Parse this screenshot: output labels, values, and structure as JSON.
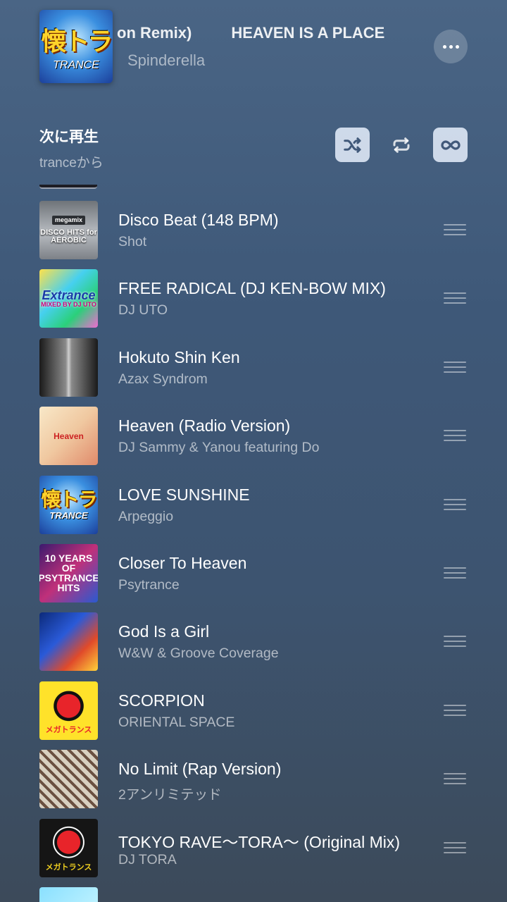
{
  "now_playing": {
    "title_visible": "on Remix)",
    "title_next": "HEAVEN IS A PLACE",
    "artist": "Spinderella",
    "artwork": {
      "text_big": "懐トラ",
      "text_small": "TRANCE"
    }
  },
  "queue": {
    "heading": "次に再生",
    "source": "tranceから",
    "controls": {
      "shuffle": "shuffle-icon",
      "repeat": "repeat-icon",
      "autoplay": "infinity-icon"
    }
  },
  "tracks": [
    {
      "title": "Disco Beat (148 BPM)",
      "artist": "Shot",
      "art_tag": "megamix",
      "art_text": "DISCO HITS for AEROBIC"
    },
    {
      "title": "FREE RADICAL (DJ KEN-BOW MIX)",
      "artist": "DJ UTO",
      "art_tag": "",
      "art_text": "Extrance",
      "art_sub": "MIXED BY DJ UTO"
    },
    {
      "title": "Hokuto Shin Ken",
      "artist": "Azax Syndrom",
      "art_text": ""
    },
    {
      "title": "Heaven (Radio Version)",
      "artist": "DJ Sammy & Yanou featuring Do",
      "art_text": "Heaven"
    },
    {
      "title": "LOVE SUNSHINE",
      "artist": "Arpeggio",
      "art_big": "懐トラ",
      "art_small": "TRANCE"
    },
    {
      "title": "Closer To Heaven",
      "artist": "Psytrance",
      "art_text": "10 YEARS OF PSYTRANCE HITS"
    },
    {
      "title": "God Is a Girl",
      "artist": "W&W & Groove Coverage",
      "art_text": ""
    },
    {
      "title": "SCORPION",
      "artist": "ORIENTAL SPACE",
      "art_sub": "メガトランス"
    },
    {
      "title": "No Limit (Rap Version)",
      "artist": "2アンリミテッド",
      "art_text": ""
    },
    {
      "title": "TOKYO RAVE〜TORA〜 (Original Mix)",
      "artist": "DJ TORA",
      "art_sub": "メガトランス"
    }
  ]
}
